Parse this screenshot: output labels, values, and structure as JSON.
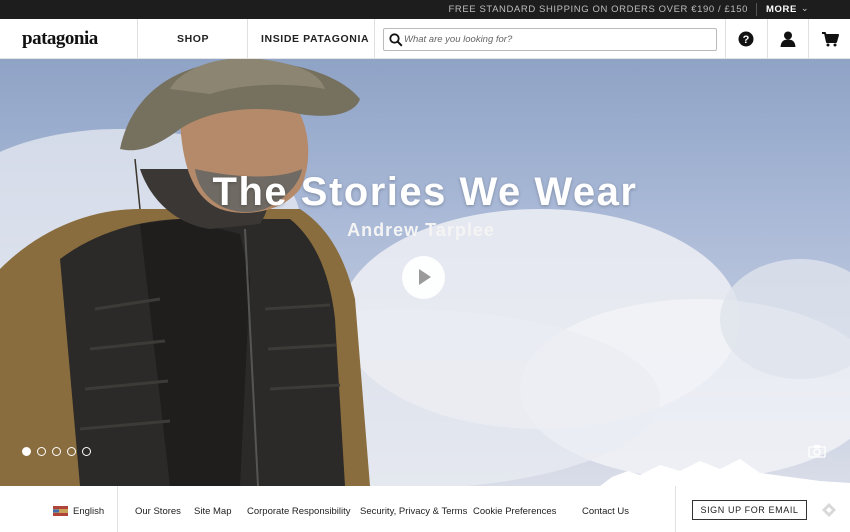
{
  "promo": {
    "text": "FREE STANDARD SHIPPING ON ORDERS OVER €190 / £150",
    "more": "MORE",
    "more_icon": "chevron-down-icon"
  },
  "header": {
    "logo": "patagonia",
    "nav": [
      "SHOP",
      "INSIDE PATAGONIA"
    ],
    "search": {
      "placeholder": "What are you looking for?",
      "value": ""
    },
    "icons": [
      "help-icon",
      "account-icon",
      "cart-icon"
    ]
  },
  "hero": {
    "title": "The Stories We Wear",
    "subtitle": "Andrew Tarplee",
    "play_icon": "play-icon",
    "slides_total": 5,
    "active_slide": 1,
    "camera_icon": "camera-icon"
  },
  "footer": {
    "language": "English",
    "links": [
      "Our Stores",
      "Site Map",
      "Corporate Responsibility",
      "Security, Privacy & Terms",
      "Cookie Preferences",
      "Contact Us"
    ],
    "signup": "SIGN UP FOR EMAIL"
  },
  "colors": {
    "topbar": "#1d1d1d",
    "accent_text": "#ffffff",
    "sky": "#a8b8d6"
  }
}
